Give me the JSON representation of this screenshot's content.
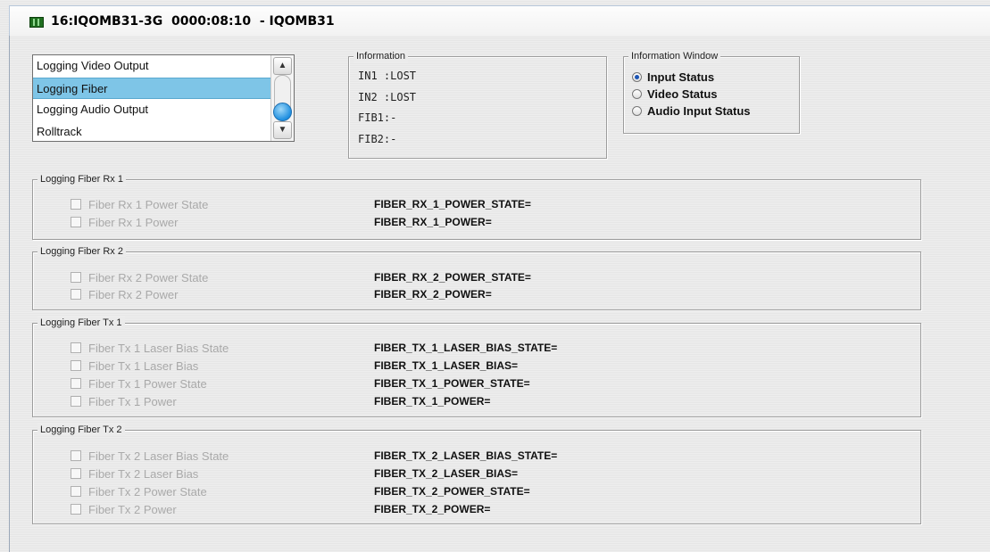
{
  "window": {
    "title": "16:IQOMB31-3G  0000:08:10  - IQOMB31",
    "icon": "status-grid-icon"
  },
  "logging_list": {
    "items": [
      "Logging Video Output",
      "Logging Fiber",
      "Logging Audio Output",
      "Rolltrack"
    ],
    "selected_index": 1,
    "scroll_up_icon": "chevron-up-icon",
    "scroll_down_icon": "chevron-down-icon"
  },
  "information": {
    "title": "Information",
    "lines": [
      "IN1 :LOST",
      "IN2 :LOST",
      "FIB1:-",
      "FIB2:-"
    ]
  },
  "information_window": {
    "title": "Information Window",
    "options": [
      "Input Status",
      "Video Status",
      "Audio Input Status"
    ],
    "selected": "Input Status"
  },
  "sections": [
    {
      "title": "Logging Fiber Rx 1",
      "rows": [
        {
          "label": "Fiber Rx 1 Power State",
          "param": "FIBER_RX_1_POWER_STATE=",
          "checked": false
        },
        {
          "label": "Fiber Rx 1 Power",
          "param": "FIBER_RX_1_POWER=",
          "checked": false
        }
      ]
    },
    {
      "title": "Logging Fiber Rx 2",
      "rows": [
        {
          "label": "Fiber Rx 2 Power State",
          "param": "FIBER_RX_2_POWER_STATE=",
          "checked": false
        },
        {
          "label": "Fiber Rx 2 Power",
          "param": "FIBER_RX_2_POWER=",
          "checked": false
        }
      ]
    },
    {
      "title": "Logging Fiber Tx 1",
      "rows": [
        {
          "label": "Fiber Tx 1 Laser Bias State",
          "param": "FIBER_TX_1_LASER_BIAS_STATE=",
          "checked": false
        },
        {
          "label": "Fiber Tx 1 Laser Bias",
          "param": "FIBER_TX_1_LASER_BIAS=",
          "checked": false
        },
        {
          "label": "Fiber Tx 1 Power State",
          "param": "FIBER_TX_1_POWER_STATE=",
          "checked": false
        },
        {
          "label": "Fiber Tx 1 Power",
          "param": "FIBER_TX_1_POWER=",
          "checked": false
        }
      ]
    },
    {
      "title": "Logging Fiber Tx 2",
      "rows": [
        {
          "label": "Fiber Tx 2 Laser Bias State",
          "param": "FIBER_TX_2_LASER_BIAS_STATE=",
          "checked": false
        },
        {
          "label": "Fiber Tx 2 Laser Bias",
          "param": "FIBER_TX_2_LASER_BIAS=",
          "checked": false
        },
        {
          "label": "Fiber Tx 2 Power State",
          "param": "FIBER_TX_2_POWER_STATE=",
          "checked": false
        },
        {
          "label": "Fiber Tx 2 Power",
          "param": "FIBER_TX_2_POWER=",
          "checked": false
        }
      ]
    }
  ]
}
